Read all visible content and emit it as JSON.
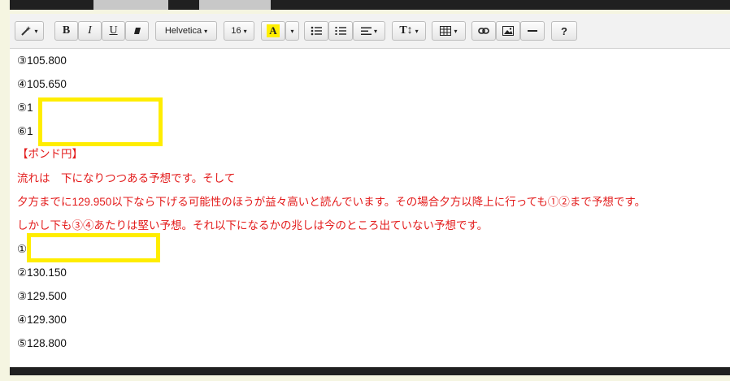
{
  "toolbar": {
    "magic_icon": "magic-wand-icon",
    "bold_label": "B",
    "italic_label": "I",
    "underline_label": "U",
    "eraser_icon": "eraser-icon",
    "font_family": "Helvetica",
    "font_size": "16",
    "highlight_label": "A",
    "highlight_color": "#ffef00",
    "ul_icon": "unordered-list-icon",
    "ol_icon": "ordered-list-icon",
    "align_icon": "align-icon",
    "text_size_label": "T↕",
    "table_icon": "table-icon",
    "link_icon": "link-icon",
    "image_icon": "image-icon",
    "hr_icon": "horizontal-rule-icon",
    "help_label": "?"
  },
  "editor": {
    "text_color": "#e31b1b",
    "lines": [
      "③105.800",
      "④105.650",
      "⑤1",
      "⑥1",
      "【ポンド円】",
      "流れは　下になりつつある予想です。そして",
      "夕方までに129.950以下なら下げる可能性のほうが益々高いと読んでいます。その場合夕方以降上に行っても①②まで予想です。",
      "しかし下も③④あたりは堅い予想。それ以下になるかの兆しは今のところ出ていない予想です。",
      "①",
      "②130.150",
      "③129.500",
      "④129.300",
      "⑤128.800"
    ]
  }
}
